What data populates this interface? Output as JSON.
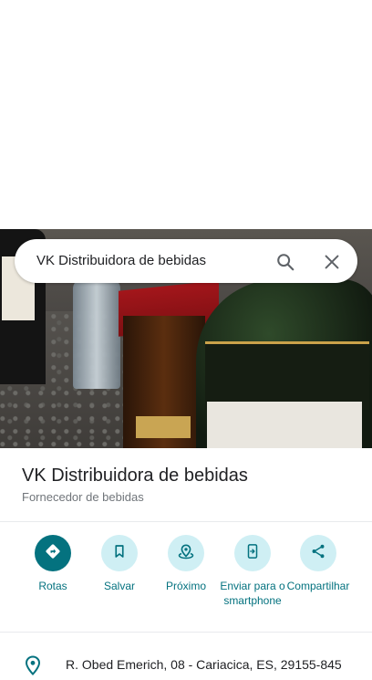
{
  "search": {
    "query": "VK Distribuidora de bebidas"
  },
  "place": {
    "name": "VK Distribuidora de bebidas",
    "category": "Fornecedor de bebidas"
  },
  "actions": [
    {
      "label": "Rotas",
      "icon": "directions-icon"
    },
    {
      "label": "Salvar",
      "icon": "bookmark-icon"
    },
    {
      "label": "Próximo",
      "icon": "nearby-icon"
    },
    {
      "label": "Enviar para o smartphone",
      "icon": "send-to-phone-icon"
    },
    {
      "label": "Compartilhar",
      "icon": "share-icon"
    }
  ],
  "address": {
    "text": "R. Obed Emerich, 08 - Cariacica, ES, 29155-845",
    "icon": "location-pin-icon"
  },
  "colors": {
    "accent": "#04727f",
    "accent_light": "#cfeff4",
    "text_secondary": "#70757a"
  }
}
